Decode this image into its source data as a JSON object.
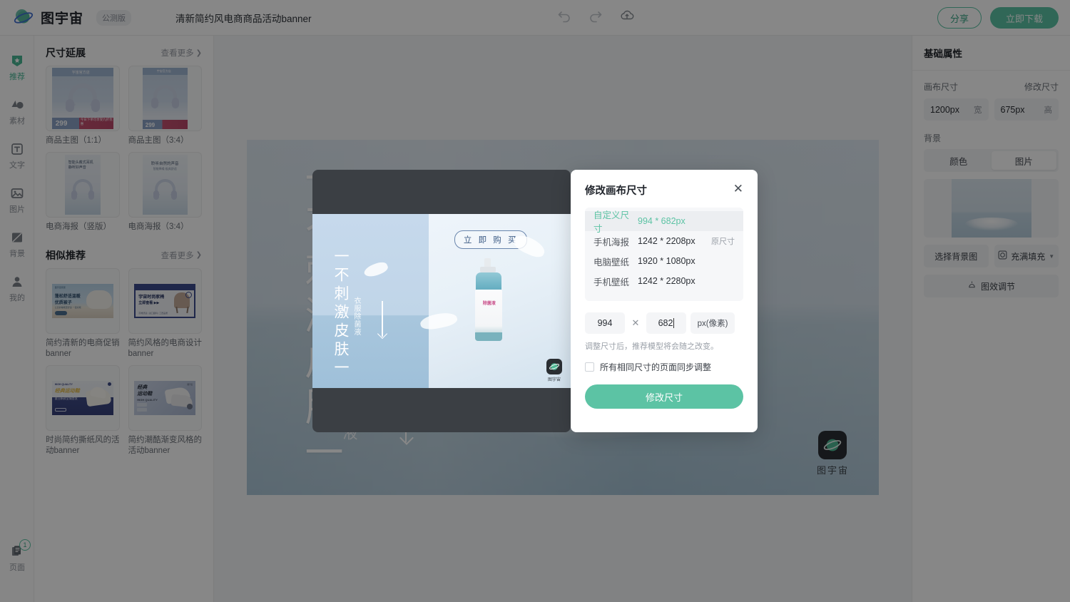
{
  "app": {
    "brand": "图宇宙",
    "beta_badge": "公测版",
    "doc_title": "清新简约风电商商品活动banner"
  },
  "topbar": {
    "undo_icon": "undo-icon",
    "redo_icon": "redo-icon",
    "upload_icon": "cloud-upload-icon",
    "share_label": "分享",
    "download_label": "立即下载"
  },
  "rail": {
    "items": [
      {
        "label": "推荐",
        "icon": "badge-star-icon",
        "active": true
      },
      {
        "label": "素材",
        "icon": "shapes-icon",
        "active": false
      },
      {
        "label": "文字",
        "icon": "text-t-icon",
        "active": false
      },
      {
        "label": "图片",
        "icon": "image-icon",
        "active": false
      },
      {
        "label": "背景",
        "icon": "background-icon",
        "active": false
      },
      {
        "label": "我的",
        "icon": "user-icon",
        "active": false
      }
    ],
    "pages": {
      "label": "页面",
      "icon": "pages-icon",
      "count": "1"
    }
  },
  "left_panel": {
    "sections": [
      {
        "title": "尺寸延展",
        "more_label": "查看更多",
        "cards": [
          {
            "label": "商品主图（1:1）",
            "art": "headphone-square"
          },
          {
            "label": "商品主图（3:4）",
            "art": "headphone-portrait"
          },
          {
            "label": "电商海报（竖版）",
            "art": "poster-a"
          },
          {
            "label": "电商海报（3:4）",
            "art": "poster-b"
          }
        ]
      },
      {
        "title": "相似推荐",
        "more_label": "查看更多",
        "cards": [
          {
            "label": "简约清新的电商促销banner",
            "art": "banner-quilt"
          },
          {
            "label": "简约风格的电商设计banner",
            "art": "banner-chair"
          },
          {
            "label": "时尚简约撕纸风的活动banner",
            "art": "banner-shoe-a"
          },
          {
            "label": "简约潮酷渐变风格的活动banner",
            "art": "banner-shoe-b"
          }
        ]
      }
    ]
  },
  "canvas": {
    "headline": "一不刺激皮肤一",
    "sub": "衣服除菌液",
    "watermark": "图宇宙"
  },
  "preview": {
    "headline": "一不刺激皮肤一",
    "sub": "衣服除菌液",
    "buy_label": "立 即 购 买",
    "bottle_label": "除菌液",
    "watermark": "图宇宙"
  },
  "right_panel": {
    "title": "基础属性",
    "canvas_size_label": "画布尺寸",
    "modify_size_label": "修改尺寸",
    "width_value": "1200px",
    "width_unit": "宽",
    "height_value": "675px",
    "height_unit": "高",
    "background_label": "背景",
    "tabs": [
      {
        "label": "颜色",
        "selected": false
      },
      {
        "label": "图片",
        "selected": true
      }
    ],
    "choose_bg_label": "选择背景图",
    "fill_mode_label": "充满填充",
    "fill_mode_icon": "fill-frame-icon",
    "chevron_icon": "chevron-down-icon",
    "effects_label": "图效调节",
    "effects_icon": "bell-adjust-icon"
  },
  "modal": {
    "title": "修改画布尺寸",
    "close_icon": "close-icon",
    "options": [
      {
        "name": "自定义尺寸",
        "size": "994 * 682px",
        "tag": "",
        "selected": true
      },
      {
        "name": "手机海报",
        "size": "1242 * 2208px",
        "tag": "原尺寸",
        "selected": false
      },
      {
        "name": "电脑壁纸",
        "size": "1920 * 1080px",
        "tag": "",
        "selected": false
      },
      {
        "name": "手机壁纸",
        "size": "1242 * 2280px",
        "tag": "",
        "selected": false
      }
    ],
    "width_value": "994",
    "height_value": "682",
    "times_symbol": "✕",
    "unit_label": "px(像素)",
    "hint": "调整尺寸后，推荐模型将会随之改变。",
    "checkbox_label": "所有相同尺寸的页面同步调整",
    "submit_label": "修改尺寸"
  },
  "colors": {
    "accent_green": "#5cc3a4",
    "accent_green_dark": "#3aa687",
    "text_primary": "#22262d",
    "text_muted": "#9aa0a8",
    "panel_bg": "#f4f5f7"
  }
}
